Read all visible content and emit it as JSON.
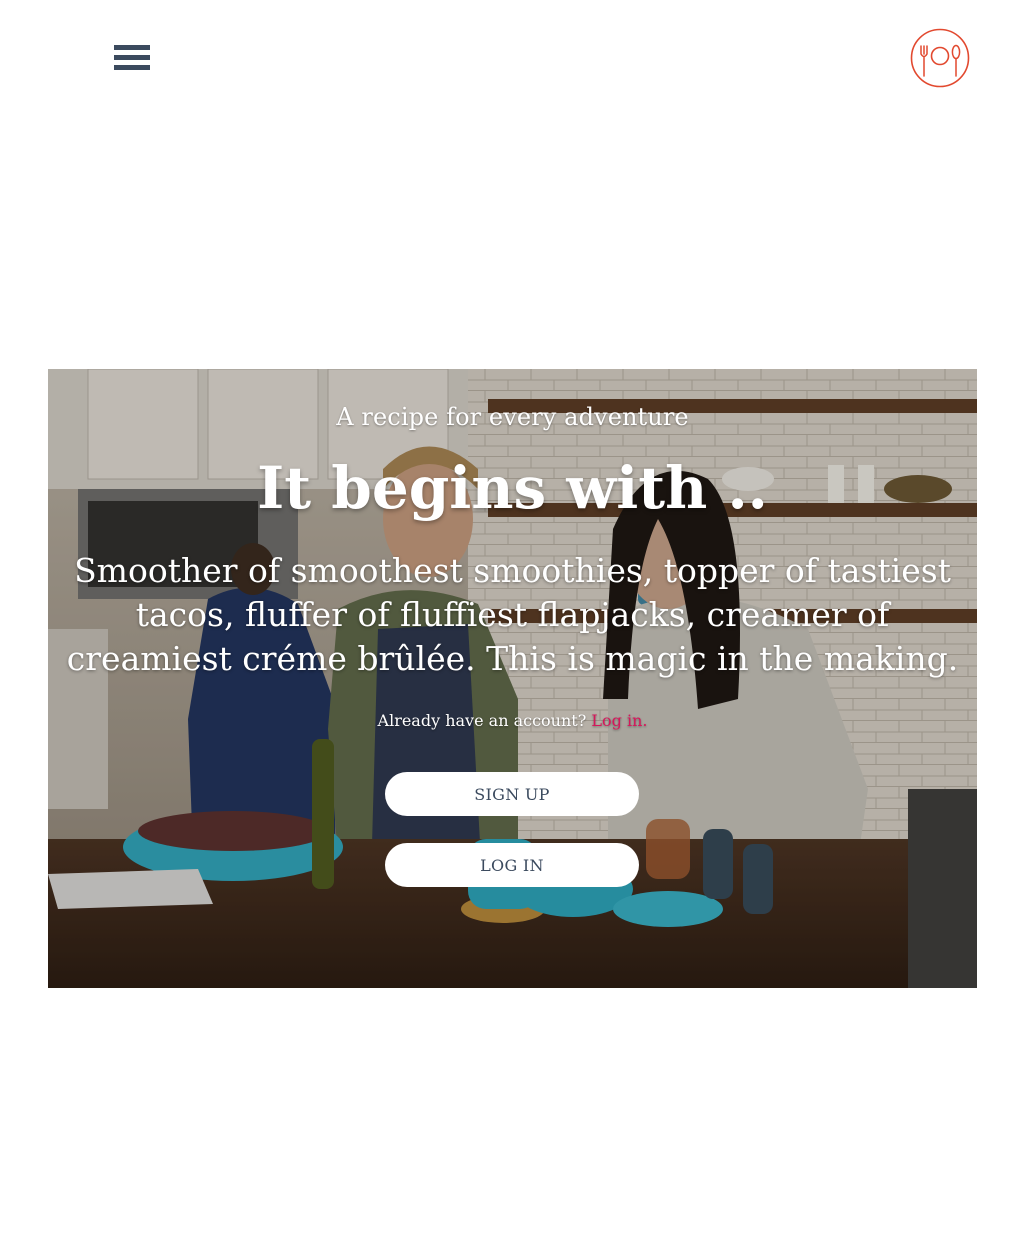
{
  "header": {
    "menu_icon": "hamburger-menu-icon",
    "logo_icon": "plate-fork-spoon-logo-icon",
    "logo_color": "#e2492f"
  },
  "hero": {
    "tagline": "A recipe for every adventure",
    "headline": "It begins with ..",
    "description": "Smoother of smoothest smoothies, topper of tastiest tacos, fluffer of fluffiest flapjacks, creamer of creamiest créme brûlée. This is magic in the making.",
    "account_prompt": "Already have an account?",
    "login_link": "Log in.",
    "signup_button": "SIGN UP",
    "login_button": "LOG IN"
  },
  "colors": {
    "text_dark": "#3b4a5e",
    "accent_link": "#d6175b",
    "button_bg": "#ffffff"
  }
}
